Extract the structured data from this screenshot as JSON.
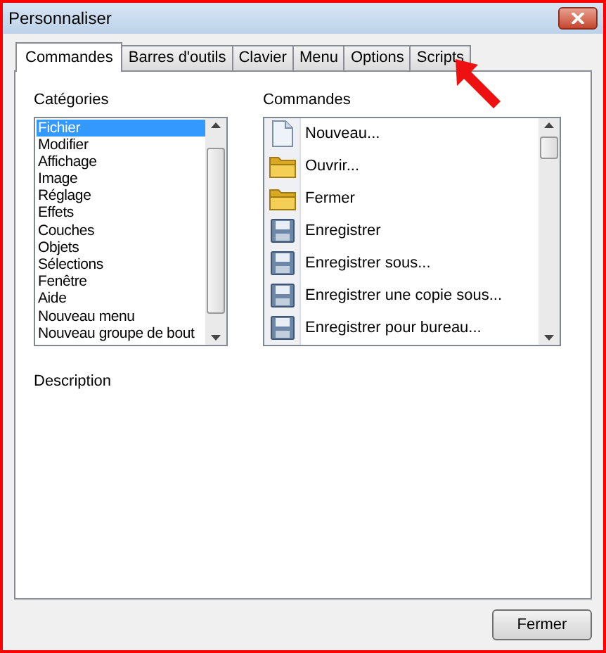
{
  "window": {
    "title": "Personnaliser"
  },
  "tabs": [
    {
      "label": "Commandes",
      "selected": true
    },
    {
      "label": "Barres d'outils",
      "selected": false
    },
    {
      "label": "Clavier",
      "selected": false
    },
    {
      "label": "Menu",
      "selected": false
    },
    {
      "label": "Options",
      "selected": false
    },
    {
      "label": "Scripts",
      "selected": false
    }
  ],
  "categories": {
    "label": "Catégories",
    "items": [
      {
        "label": "Fichier",
        "selected": true
      },
      {
        "label": "Modifier",
        "selected": false
      },
      {
        "label": "Affichage",
        "selected": false
      },
      {
        "label": "Image",
        "selected": false
      },
      {
        "label": "Réglage",
        "selected": false
      },
      {
        "label": "Effets",
        "selected": false
      },
      {
        "label": "Couches",
        "selected": false
      },
      {
        "label": "Objets",
        "selected": false
      },
      {
        "label": "Sélections",
        "selected": false
      },
      {
        "label": "Fenêtre",
        "selected": false
      },
      {
        "label": "Aide",
        "selected": false
      },
      {
        "label": "Nouveau menu",
        "selected": false
      },
      {
        "label": "Nouveau groupe de bout",
        "selected": false
      }
    ]
  },
  "commands": {
    "label": "Commandes",
    "items": [
      {
        "label": "Nouveau...",
        "kind": "document"
      },
      {
        "label": "Ouvrir...",
        "kind": "folder"
      },
      {
        "label": "Fermer",
        "kind": "folder"
      },
      {
        "label": "Enregistrer",
        "kind": "floppy"
      },
      {
        "label": "Enregistrer sous...",
        "kind": "floppy"
      },
      {
        "label": "Enregistrer une copie sous...",
        "kind": "floppy"
      },
      {
        "label": "Enregistrer pour bureau...",
        "kind": "floppy"
      }
    ]
  },
  "description": {
    "label": "Description"
  },
  "buttons": [
    "Fermer"
  ]
}
